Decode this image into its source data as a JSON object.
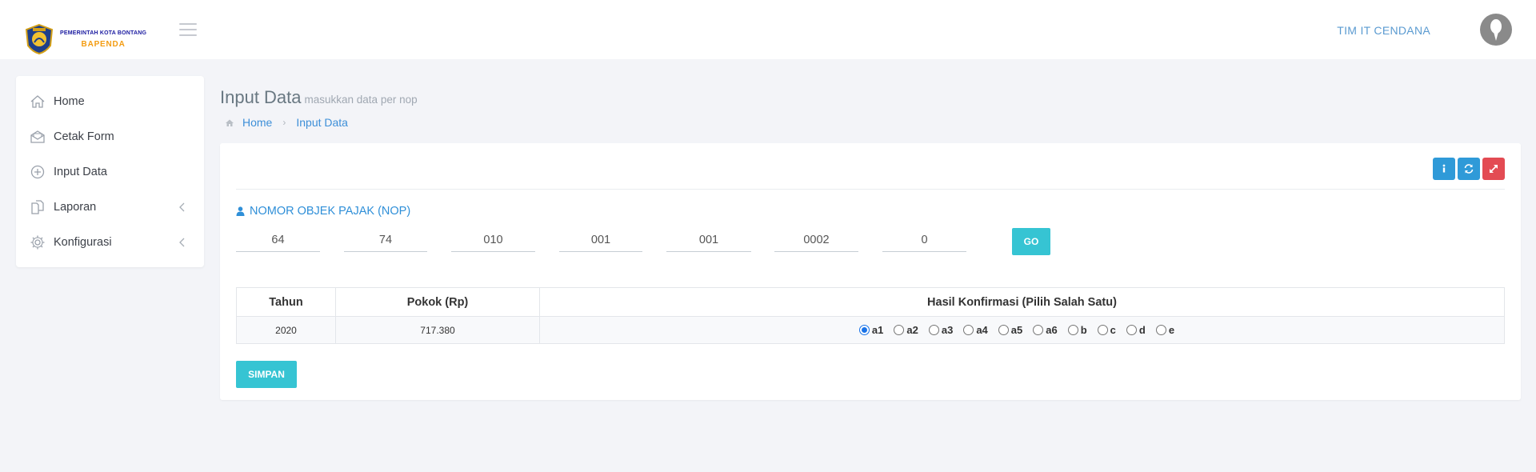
{
  "header": {
    "logo_line1": "PEMERINTAH KOTA BONTANG",
    "logo_line2": "BAPENDA",
    "user_name": "TIM IT CENDANA"
  },
  "sidebar": {
    "items": [
      {
        "label": "Home",
        "icon": "home-icon"
      },
      {
        "label": "Cetak Form",
        "icon": "envelope-open-icon"
      },
      {
        "label": "Input Data",
        "icon": "plus-circle-icon"
      },
      {
        "label": "Laporan",
        "icon": "documents-icon",
        "has_submenu": true
      },
      {
        "label": "Konfigurasi",
        "icon": "gear-icon",
        "has_submenu": true
      }
    ]
  },
  "page": {
    "title": "Input Data",
    "subtitle": "masukkan data per nop",
    "breadcrumb": [
      "Home",
      "Input Data"
    ]
  },
  "form": {
    "nop_title": "NOMOR OBJEK PAJAK (NOP)",
    "nop_fields": [
      "64",
      "74",
      "010",
      "001",
      "001",
      "0002",
      "0"
    ],
    "go_label": "GO",
    "save_label": "SIMPAN"
  },
  "table": {
    "headers": [
      "Tahun",
      "Pokok (Rp)",
      "Hasil Konfirmasi (Pilih Salah Satu)"
    ],
    "rows": [
      {
        "tahun": "2020",
        "pokok": "717.380",
        "selected": "a1"
      }
    ],
    "options": [
      "a1",
      "a2",
      "a3",
      "a4",
      "a5",
      "a6",
      "b",
      "c",
      "d",
      "e"
    ]
  },
  "colors": {
    "accent": "#36c4d3",
    "link": "#2f8fd8",
    "danger": "#e34b53"
  }
}
